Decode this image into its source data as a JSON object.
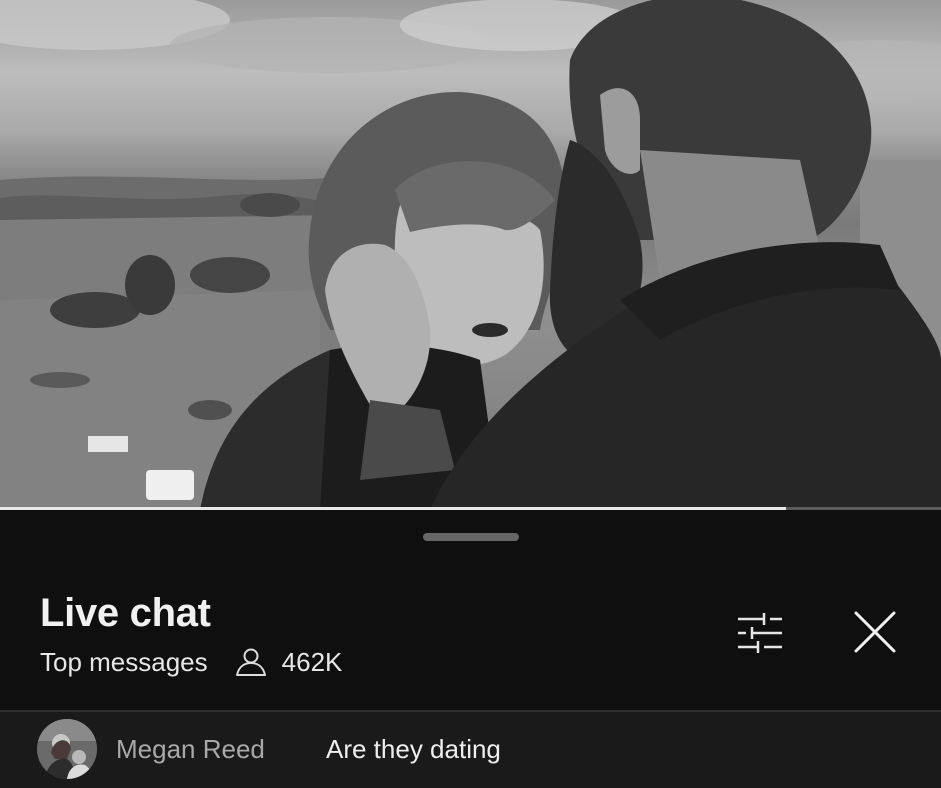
{
  "video": {
    "description_icon": "video-frame",
    "progress": 0.835
  },
  "chat": {
    "title": "Live chat",
    "mode": "Top messages",
    "viewer_count": "462K",
    "icons": {
      "viewers": "person-icon",
      "filter": "sliders-icon",
      "close": "close-icon"
    },
    "messages": [
      {
        "author": "Megan Reed",
        "text": "Are they dating"
      }
    ]
  },
  "colors": {
    "background": "#0f0f0f",
    "row_background": "#1a1a1a",
    "title": "#f1f1f1",
    "author": "#a9a9a9"
  }
}
